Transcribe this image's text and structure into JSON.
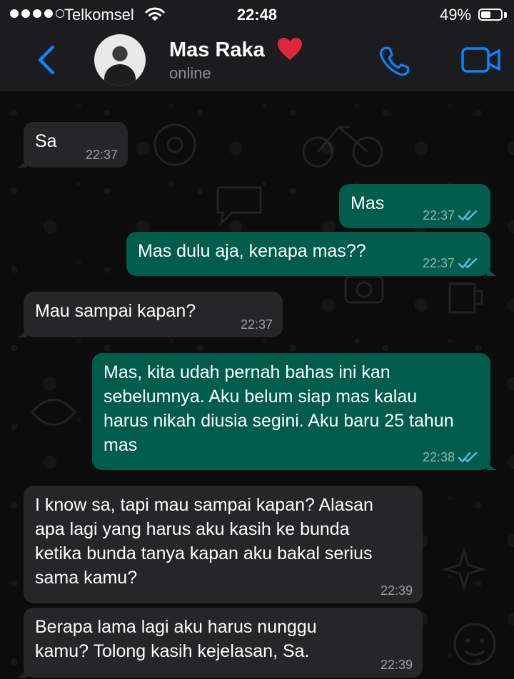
{
  "status_bar": {
    "carrier": "Telkomsel",
    "time": "22:48",
    "battery_percent": "49%",
    "battery_level": 0.49
  },
  "header": {
    "contact_name": "Mas Raka",
    "status": "online",
    "icons": [
      "back-chevron-icon",
      "avatar",
      "heart-emoji",
      "phone-icon",
      "video-call-icon"
    ],
    "accent_color": "#0a84ff"
  },
  "messages": [
    {
      "direction": "in",
      "text": "Sa",
      "time": "22:37"
    },
    {
      "direction": "out",
      "text": "Mas",
      "time": "22:37",
      "read": true
    },
    {
      "direction": "out",
      "text": "Mas dulu aja, kenapa mas??",
      "time": "22:37",
      "read": true
    },
    {
      "direction": "in",
      "text": "Mau sampai kapan?",
      "time": "22:37"
    },
    {
      "direction": "out",
      "text": "Mas, kita udah pernah bahas ini kan sebelumnya. Aku belum siap mas kalau harus nikah diusia segini. Aku baru 25 tahun mas",
      "time": "22:38",
      "read": true
    },
    {
      "direction": "in",
      "text": "I know sa, tapi mau sampai kapan? Alasan apa lagi yang harus aku kasih ke bunda ketika bunda tanya kapan aku bakal serius sama kamu?",
      "time": "22:39"
    },
    {
      "direction": "in",
      "text": "Berapa lama lagi aku harus nunggu kamu? Tolong kasih kejelasan, Sa.",
      "time": "22:39"
    }
  ],
  "colors": {
    "incoming_bubble": "#262628",
    "outgoing_bubble": "#005c4b",
    "read_ticks": "#53bdeb",
    "header_bg": "#1c1c1e"
  }
}
